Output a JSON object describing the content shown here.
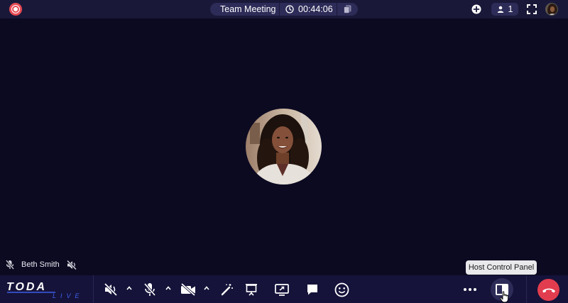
{
  "header": {
    "meeting_title": "Team Meeting",
    "timer": "00:44:06",
    "participant_count": "1"
  },
  "participant": {
    "name": "Beth Smith"
  },
  "tooltip": {
    "host_control_panel": "Host Control Panel"
  },
  "brand": {
    "logo_top": "TODA",
    "logo_bottom": "LIVE"
  },
  "icons": {
    "record": "record-icon",
    "timer": "clock-icon",
    "copy": "copy-icon",
    "add": "plus-icon",
    "participants": "person-icon",
    "fullscreen": "fullscreen-icon",
    "speaker_muted": "speaker-muted-icon",
    "mic_muted": "mic-muted-icon",
    "camera_off": "camera-off-icon",
    "effects": "magic-wand-icon",
    "whiteboard": "presentation-board-icon",
    "screen_share": "screen-share-icon",
    "chat": "chat-icon",
    "reactions": "smiley-icon",
    "more": "more-icon",
    "panel": "panel-icon",
    "hangup": "phone-hangup-icon"
  },
  "colors": {
    "background": "#0c0a21",
    "topbar": "#1a1838",
    "bottombar": "#15133a",
    "pill": "#2d2b57",
    "record_red": "#e84a55",
    "hangup_red": "#e23d4e",
    "logo_accent": "#3f5ee8"
  }
}
